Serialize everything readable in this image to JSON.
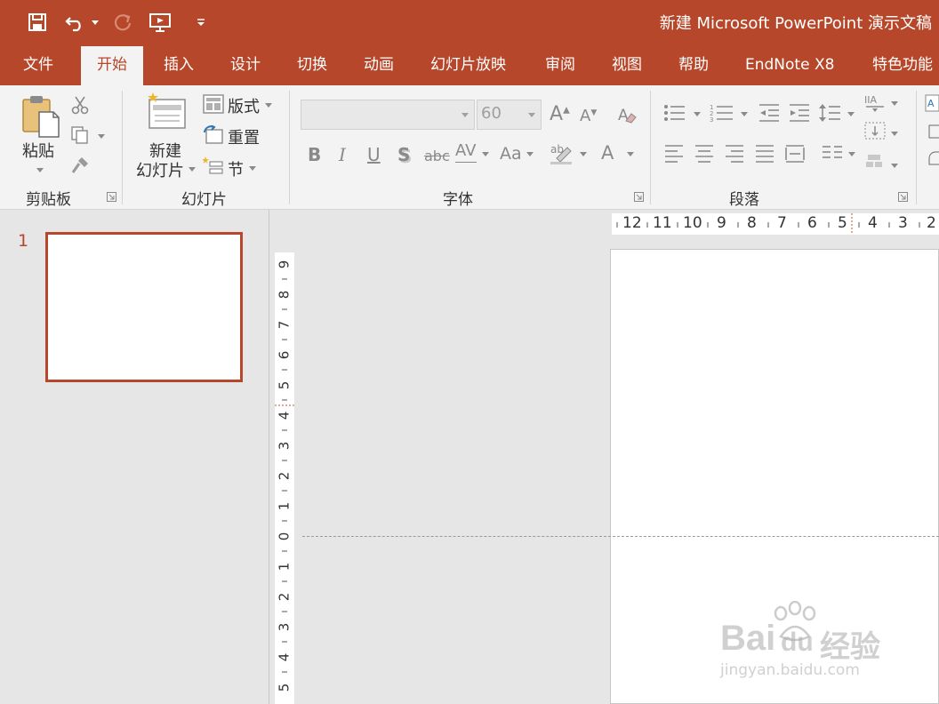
{
  "window": {
    "title": "新建 Microsoft PowerPoint 演示文稿",
    "accent": "#b7472a"
  },
  "quick_access": [
    {
      "icon": "save-icon"
    },
    {
      "icon": "undo-icon"
    },
    {
      "icon": "redo-icon"
    },
    {
      "icon": "present-from-start-icon"
    },
    {
      "icon": "customize-qat-icon"
    }
  ],
  "tabs": [
    "文件",
    "开始",
    "插入",
    "设计",
    "切换",
    "动画",
    "幻灯片放映",
    "审阅",
    "视图",
    "帮助",
    "EndNote X8",
    "特色功能"
  ],
  "active_tab": "开始",
  "ribbon": {
    "clipboard": {
      "label": "剪贴板",
      "paste": "粘贴"
    },
    "slides": {
      "label": "幻灯片",
      "new_slide_line1": "新建",
      "new_slide_line2": "幻灯片",
      "layout": "版式",
      "reset": "重置",
      "section": "节"
    },
    "font": {
      "label": "字体",
      "font_name": "",
      "font_size": "60"
    },
    "paragraph": {
      "label": "段落"
    }
  },
  "thumbnails": [
    {
      "number": "1"
    }
  ],
  "ruler": {
    "horizontal": [
      "12",
      "11",
      "10",
      "9",
      "8",
      "7",
      "6",
      "5",
      "4",
      "3",
      "2"
    ],
    "vertical": [
      "9",
      "8",
      "7",
      "6",
      "5",
      "4",
      "3",
      "2",
      "1",
      "0",
      "1",
      "2",
      "3",
      "4",
      "5"
    ]
  },
  "watermark": {
    "brand": "Bai",
    "brand2": "du",
    "cn": "经验",
    "url": "jingyan.baidu.com"
  }
}
